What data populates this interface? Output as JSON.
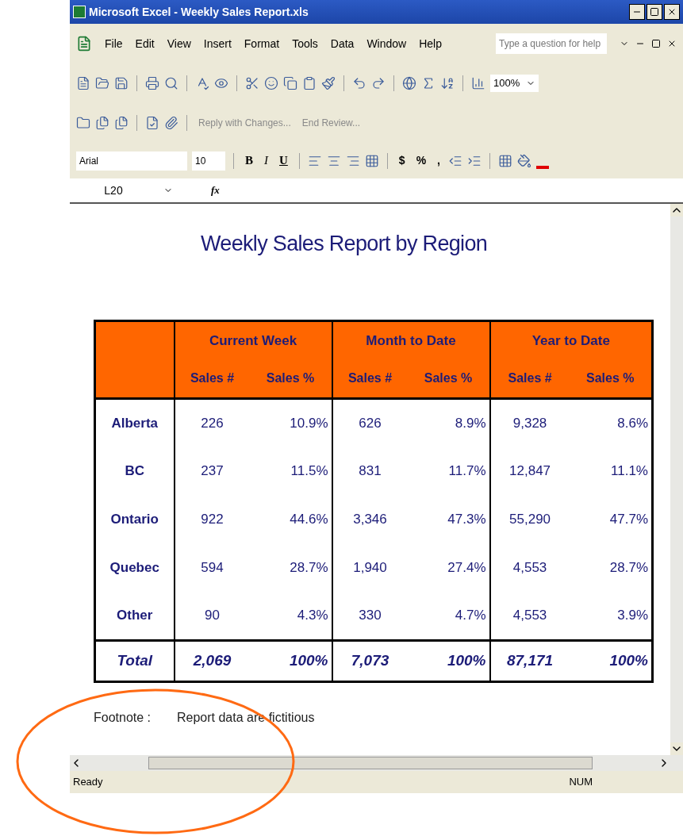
{
  "window": {
    "title": "Microsoft Excel - Weekly Sales Report.xls"
  },
  "menu": [
    "File",
    "Edit",
    "View",
    "Insert",
    "Format",
    "Tools",
    "Data",
    "Window",
    "Help"
  ],
  "help_box": {
    "placeholder": "Type a question for help"
  },
  "standard_toolbar": {
    "zoom": "100%"
  },
  "review_toolbar": {
    "buttons": [
      "Reply with Changes...",
      "End Review..."
    ]
  },
  "format_toolbar": {
    "font": "Arial",
    "size": "10",
    "style_buttons": [
      "B",
      "I",
      "U"
    ],
    "number_buttons": [
      "$",
      "%",
      ","
    ]
  },
  "formula_bar": {
    "name_box": "L20",
    "fx": "fx"
  },
  "sheet": {
    "title": "Weekly Sales Report by Region",
    "groups": [
      "Current Week",
      "Month to Date",
      "Year to Date"
    ],
    "subheaders": [
      "Sales #",
      "Sales %",
      "Sales #",
      "Sales %",
      "Sales #",
      "Sales %"
    ],
    "rows": [
      {
        "region": "Alberta",
        "cells": [
          "226",
          "10.9%",
          "626",
          "8.9%",
          "9,328",
          "8.6%"
        ]
      },
      {
        "region": "BC",
        "cells": [
          "237",
          "11.5%",
          "831",
          "11.7%",
          "12,847",
          "11.1%"
        ]
      },
      {
        "region": "Ontario",
        "cells": [
          "922",
          "44.6%",
          "3,346",
          "47.3%",
          "55,290",
          "47.7%"
        ]
      },
      {
        "region": "Quebec",
        "cells": [
          "594",
          "28.7%",
          "1,940",
          "27.4%",
          "4,553",
          "28.7%"
        ]
      },
      {
        "region": "Other",
        "cells": [
          "90",
          "4.3%",
          "330",
          "4.7%",
          "4,553",
          "3.9%"
        ]
      }
    ],
    "total": {
      "label": "Total",
      "cells": [
        "2,069",
        "100%",
        "7,073",
        "100%",
        "87,171",
        "100%"
      ]
    },
    "footnote": {
      "label": "Footnote :",
      "text": "Report data are fictitious"
    }
  },
  "status_bar": {
    "status": "Ready",
    "indicator": "NUM"
  },
  "annotation": {
    "kind": "ellipse",
    "color": "#ff6a13"
  }
}
